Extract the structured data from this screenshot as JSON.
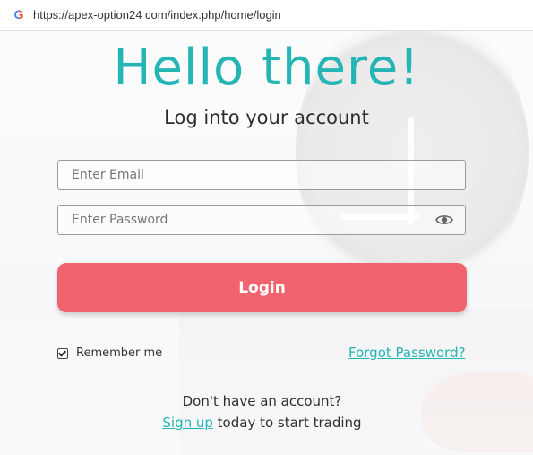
{
  "browser": {
    "url": "https://apex-option24 com/index.php/home/login",
    "favicon_letter": "G"
  },
  "login": {
    "title": "Hello there!",
    "subtitle": "Log into your account",
    "email_placeholder": "Enter Email",
    "password_placeholder": "Enter Password",
    "login_label": "Login",
    "remember_label": "Remember me",
    "remember_checked": true,
    "forgot_label": "Forgot Password?",
    "no_account_text": "Don't have an account?",
    "signup_link": "Sign up",
    "signup_suffix": " today to start trading"
  },
  "colors": {
    "accent": "#25b5b5",
    "button": "#f0636f"
  },
  "icons": {
    "password_toggle": "eye-icon",
    "remember": "checkbox-checked-icon"
  }
}
